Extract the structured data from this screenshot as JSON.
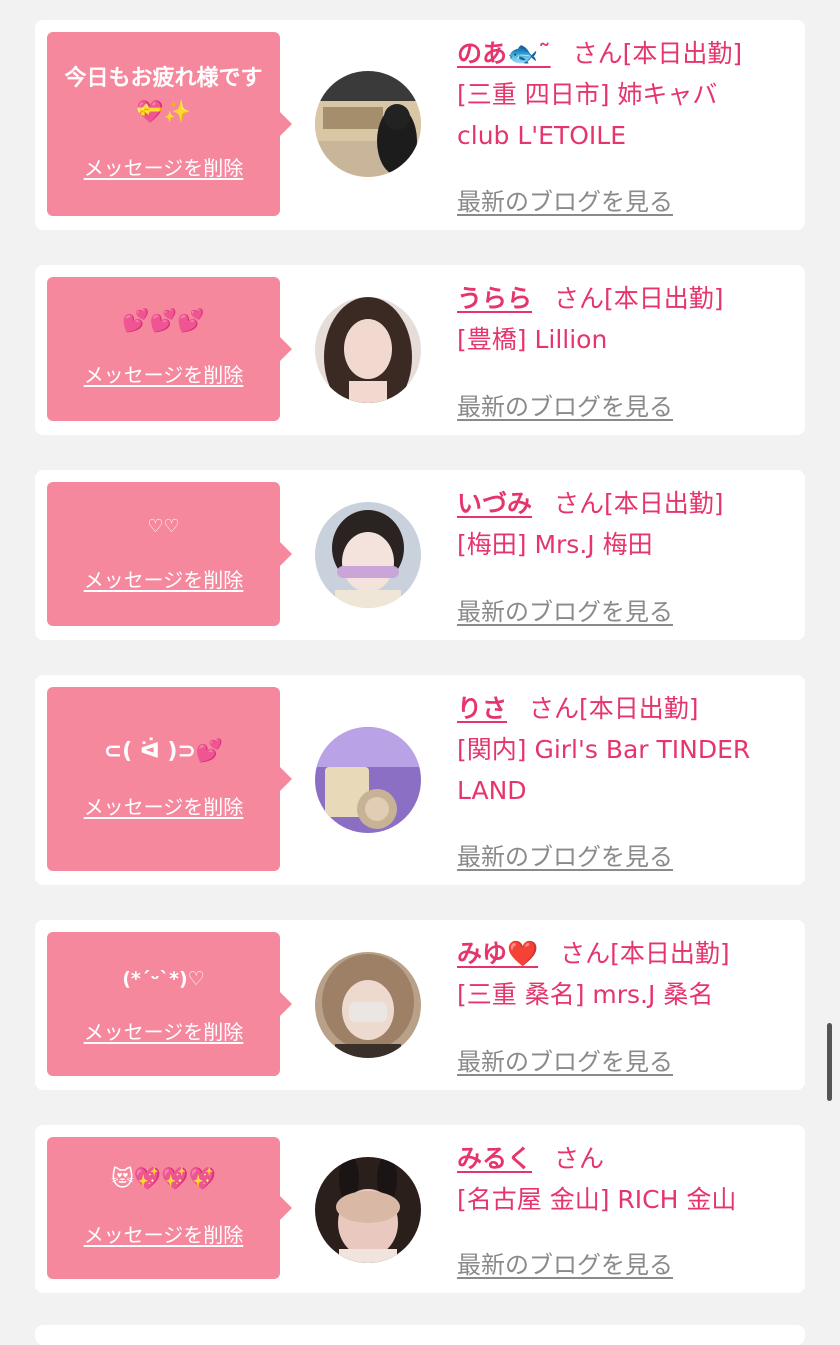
{
  "delete_label": "メッセージを削除",
  "blog_label": "最新のブログを見る",
  "honorific": "さん",
  "colors": {
    "accent": "#e5356c",
    "bubble": "#f6889e",
    "link_gray": "#8a8a8a",
    "background": "#f2f2f2"
  },
  "messages": [
    {
      "message": "今日もお疲れ様です💝✨",
      "name": "のあ🐟˜",
      "status": "[本日出勤]",
      "shop_line1": "[三重 四日市] 姉キャバ",
      "shop_line2": "club L'ETOILE"
    },
    {
      "message": "💕💕💕",
      "name": "うらら",
      "status": "[本日出勤]",
      "shop_line1": "[豊橋] Lillion",
      "shop_line2": ""
    },
    {
      "message": "♡♡",
      "name": "いづみ",
      "status": "[本日出勤]",
      "shop_line1": "[梅田] Mrs.J 梅田",
      "shop_line2": ""
    },
    {
      "message": "⊂( ᐛ )⊃💕",
      "name": "りさ",
      "status": "[本日出勤]",
      "shop_line1": "[関内] Girl's Bar TINDER",
      "shop_line2": "LAND"
    },
    {
      "message": "(*ˊᵕˋ*)♡",
      "name": "みゆ❤️",
      "status": "[本日出勤]",
      "shop_line1": "[三重 桑名] mrs.J 桑名",
      "shop_line2": ""
    },
    {
      "message": "😻💖💖💖",
      "name": "みるく",
      "status": "",
      "shop_line1": "[名古屋 金山] RICH 金山",
      "shop_line2": ""
    }
  ]
}
